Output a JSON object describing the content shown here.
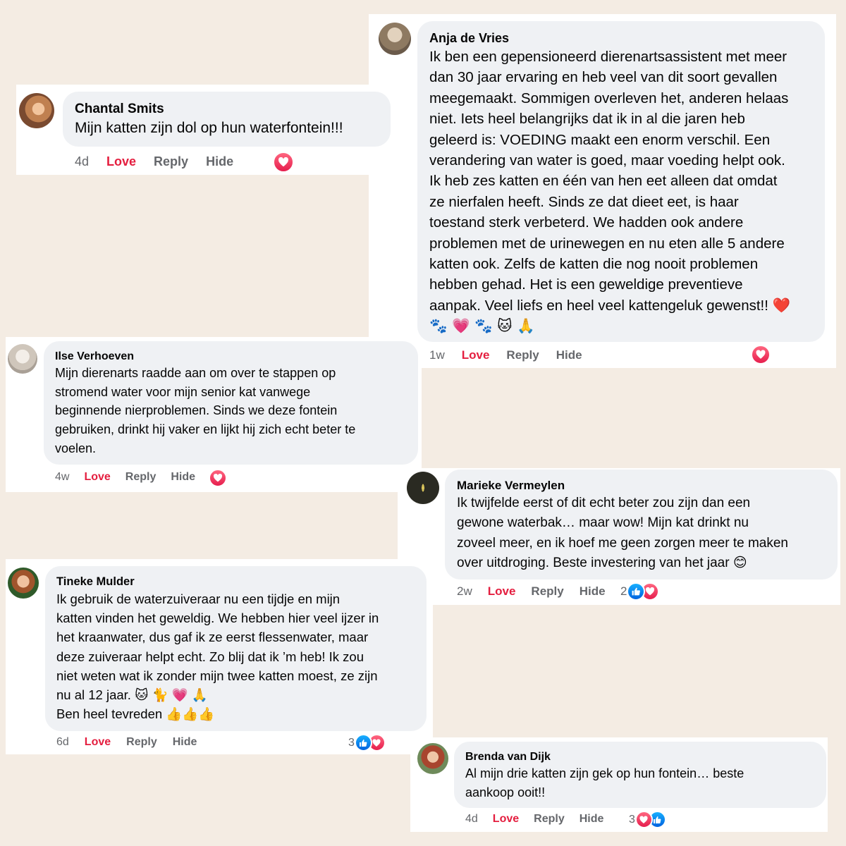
{
  "comments": {
    "anja": {
      "name": "Anja de Vries",
      "lines": [
        "Ik ben een gepensioneerd dierenartsassistent met meer",
        "dan 30 jaar ervaring en heb veel van dit soort gevallen",
        "meegemaakt. Sommigen overleven het, anderen helaas",
        "niet. Iets heel belangrijks dat ik in al die jaren heb",
        "geleerd is: VOEDING maakt een enorm verschil. Een",
        "verandering van water is goed, maar voeding helpt ook.",
        "Ik heb zes katten en één van hen eet alleen dat omdat",
        "ze nierfalen heeft. Sinds ze dat dieet eet, is haar",
        "toestand sterk verbeterd. We hadden ook andere",
        "problemen met de urinewegen en nu eten alle 5 andere",
        "katten ook. Zelfs de katten die nog nooit problemen",
        "hebben gehad. Het is een geweldige preventieve",
        "aanpak. Veel liefs en heel veel kattengeluk gewenst!! ❤️",
        "🐾 💗 🐾 🐱 🙏"
      ],
      "time": "1w",
      "love": "Love",
      "reply": "Reply",
      "hide": "Hide"
    },
    "chantal": {
      "name": "Chantal Smits",
      "lines": [
        "Mijn katten zijn dol op hun waterfontein!!!"
      ],
      "time": "4d",
      "love": "Love",
      "reply": "Reply",
      "hide": "Hide"
    },
    "ilse": {
      "name": "Ilse Verhoeven",
      "lines": [
        "Mijn dierenarts raadde aan om over te stappen op",
        "stromend water voor mijn senior kat vanwege",
        "beginnende nierproblemen. Sinds we deze fontein",
        "gebruiken, drinkt hij vaker en lijkt hij zich echt beter te",
        "voelen."
      ],
      "time": "4w",
      "love": "Love",
      "reply": "Reply",
      "hide": "Hide"
    },
    "marieke": {
      "name": "Marieke Vermeylen",
      "lines": [
        "Ik twijfelde eerst of dit echt beter zou zijn dan een",
        "gewone waterbak… maar wow! Mijn kat drinkt nu",
        "zoveel meer, en ik hoef me geen zorgen meer te maken",
        "over uitdroging. Beste investering van het jaar 😊"
      ],
      "time": "2w",
      "love": "Love",
      "reply": "Reply",
      "hide": "Hide",
      "reaction_count": "2"
    },
    "tineke": {
      "name": "Tineke Mulder",
      "lines": [
        "Ik gebruik de waterzuiveraar nu een tijdje en mijn",
        "katten vinden het geweldig. We hebben hier veel ijzer in",
        "het kraanwater, dus gaf ik ze eerst flessenwater, maar",
        "deze zuiveraar helpt echt. Zo blij dat ik ’m heb! Ik zou",
        "niet weten wat ik zonder mijn twee katten moest, ze zijn",
        "nu al 12 jaar. 🐱 🐈 💗 🙏",
        "Ben heel tevreden 👍👍👍"
      ],
      "time": "6d",
      "love": "Love",
      "reply": "Reply",
      "hide": "Hide",
      "reaction_count": "3"
    },
    "brenda": {
      "name": "Brenda van Dijk",
      "lines": [
        "Al mijn drie katten zijn gek op hun fontein… beste",
        "aankoop ooit!!"
      ],
      "time": "4d",
      "love": "Love",
      "reply": "Reply",
      "hide": "Hide",
      "reaction_count": "3"
    }
  },
  "icons": {
    "heart_reaction": "heart-icon",
    "like_reaction": "thumbs-up-icon",
    "heart_color": "#e61e4d",
    "like_color": "#0866ff",
    "love_color": "#e41e3f"
  }
}
